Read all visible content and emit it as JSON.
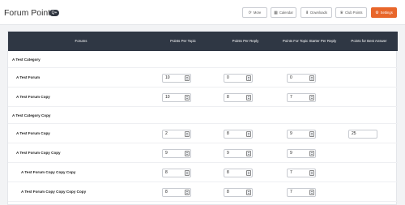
{
  "header": {
    "title": "Forum Points",
    "badge": "Q+",
    "buttons": [
      {
        "label": "More",
        "icon": "more-icon"
      },
      {
        "label": "Calendar",
        "icon": "calendar-icon"
      },
      {
        "label": "Downloads",
        "icon": "download-icon"
      },
      {
        "label": "Club Points",
        "icon": "trophy-icon"
      },
      {
        "label": "Settings",
        "icon": "gear-icon"
      }
    ]
  },
  "table": {
    "columns": [
      "Forums",
      "Points Per Topic",
      "Points Per Reply",
      "Points For Topic Starter Per Reply",
      "Points for Best Answer"
    ],
    "rows": [
      {
        "type": "category",
        "name": "A Test Category"
      },
      {
        "type": "forum",
        "name": "A Test Forum",
        "topic": "10",
        "reply": "0",
        "starter": "0",
        "best": null
      },
      {
        "type": "forum",
        "name": "A Test Forum Copy",
        "topic": "10",
        "reply": "8",
        "starter": "7",
        "best": null
      },
      {
        "type": "category",
        "name": "A Test Category Copy"
      },
      {
        "type": "forum",
        "name": "A Test Forum Copy",
        "topic": "2",
        "reply": "8",
        "starter": "9",
        "best": "25"
      },
      {
        "type": "forum",
        "name": "A Test Forum Copy Copy",
        "topic": "9",
        "reply": "9",
        "starter": "9",
        "best": null
      },
      {
        "type": "forum",
        "name": "A Test Forum Copy Copy Copy",
        "topic": "8",
        "reply": "8",
        "starter": "7",
        "best": null
      },
      {
        "type": "forum",
        "name": "A Test Forum Copy Copy Copy Copy",
        "topic": "8",
        "reply": "8",
        "starter": "7",
        "best": null
      }
    ]
  },
  "colors": {
    "accent": "#e8662a",
    "header_bg": "#2f3744"
  }
}
